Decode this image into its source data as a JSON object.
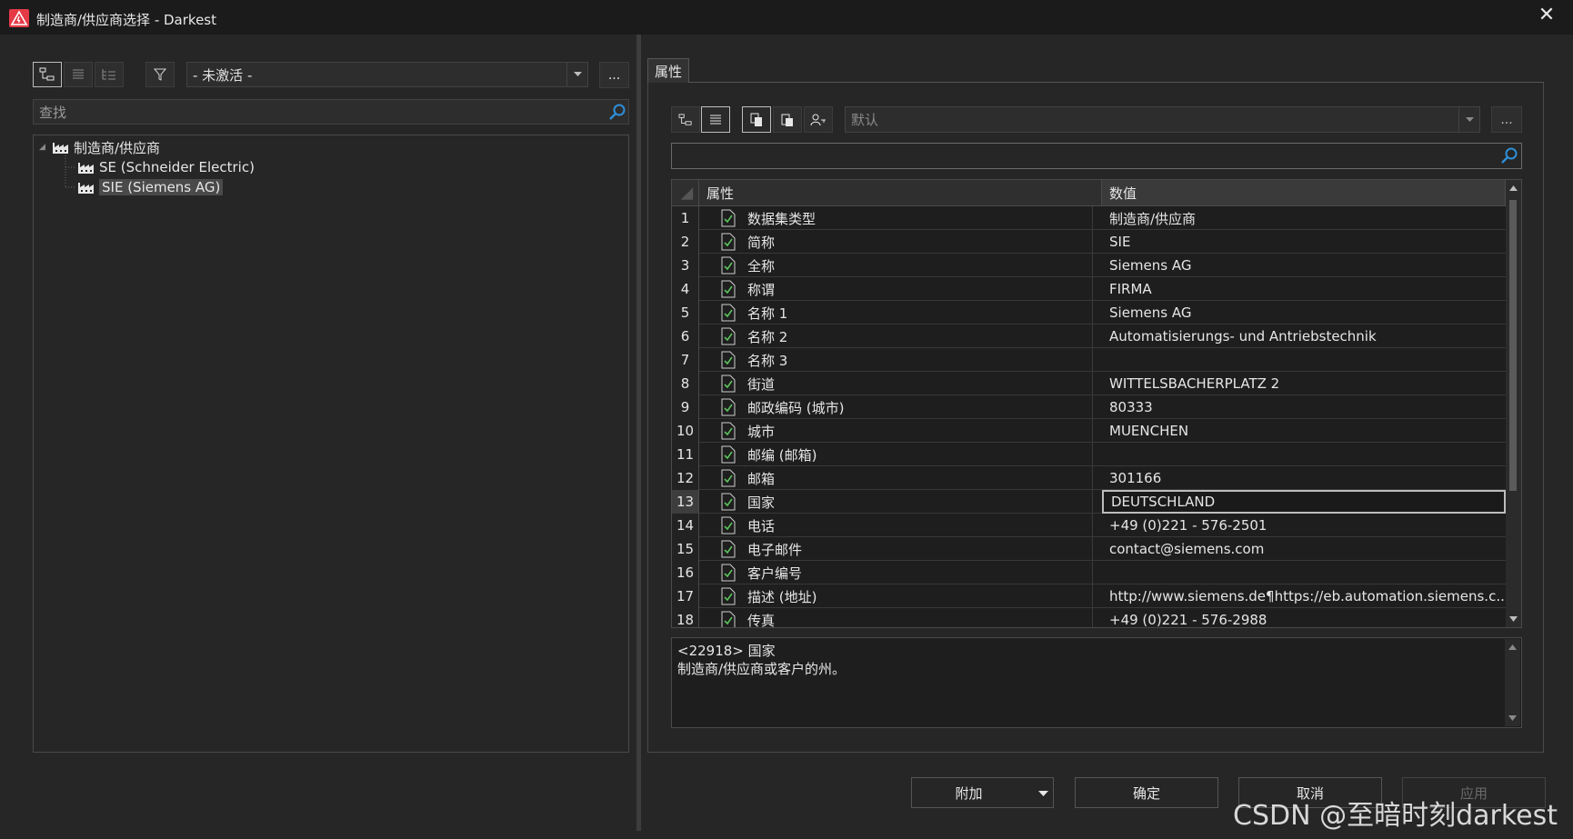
{
  "window": {
    "title": "制造商/供应商选择 - Darkest",
    "close_glyph": "✕"
  },
  "left": {
    "filter_value": "- 未激活 -",
    "more_label": "...",
    "search_placeholder": "查找",
    "tree": {
      "root": "制造商/供应商",
      "children": [
        "SE (Schneider Electric)",
        "SIE (Siemens AG)"
      ]
    }
  },
  "right": {
    "tab_label": "属性",
    "scheme_value": "默认",
    "more_label": "...",
    "search_value": "",
    "columns": {
      "property": "属性",
      "value": "数值"
    },
    "rows": [
      {
        "num": "1",
        "property": "数据集类型",
        "value": "制造商/供应商"
      },
      {
        "num": "2",
        "property": "简称",
        "value": "SIE"
      },
      {
        "num": "3",
        "property": "全称",
        "value": "Siemens AG"
      },
      {
        "num": "4",
        "property": "称谓",
        "value": "FIRMA"
      },
      {
        "num": "5",
        "property": "名称 1",
        "value": "Siemens AG"
      },
      {
        "num": "6",
        "property": "名称 2",
        "value": "Automatisierungs- und Antriebstechnik"
      },
      {
        "num": "7",
        "property": "名称 3",
        "value": ""
      },
      {
        "num": "8",
        "property": "街道",
        "value": "WITTELSBACHERPLATZ 2"
      },
      {
        "num": "9",
        "property": "邮政编码 (城市)",
        "value": "80333"
      },
      {
        "num": "10",
        "property": "城市",
        "value": "MUENCHEN"
      },
      {
        "num": "11",
        "property": "邮编 (邮箱)",
        "value": ""
      },
      {
        "num": "12",
        "property": "邮箱",
        "value": "301166"
      },
      {
        "num": "13",
        "property": "国家",
        "value": "DEUTSCHLAND"
      },
      {
        "num": "14",
        "property": "电话",
        "value": "+49 (0)221 - 576-2501"
      },
      {
        "num": "15",
        "property": "电子邮件",
        "value": "contact@siemens.com"
      },
      {
        "num": "16",
        "property": "客户编号",
        "value": ""
      },
      {
        "num": "17",
        "property": "描述 (地址)",
        "value": "http://www.siemens.de¶https://eb.automation.siemens.c..."
      },
      {
        "num": "18",
        "property": "传真",
        "value": "+49 (0)221 - 576-2988"
      }
    ],
    "selected_row": "13",
    "description": {
      "line1": "<22918> 国家",
      "line2": "制造商/供应商或客户的州。"
    }
  },
  "buttons": {
    "extra": "附加",
    "ok": "确定",
    "cancel": "取消",
    "apply": "应用"
  },
  "watermark": "CSDN @至暗时刻darkest",
  "colors": {
    "background": "#262626",
    "titlebar": "#1b1b1b",
    "accent_search": "#2f8fd8",
    "icon_red": "#e53946",
    "doc_icon_green": "#5cc15c"
  }
}
